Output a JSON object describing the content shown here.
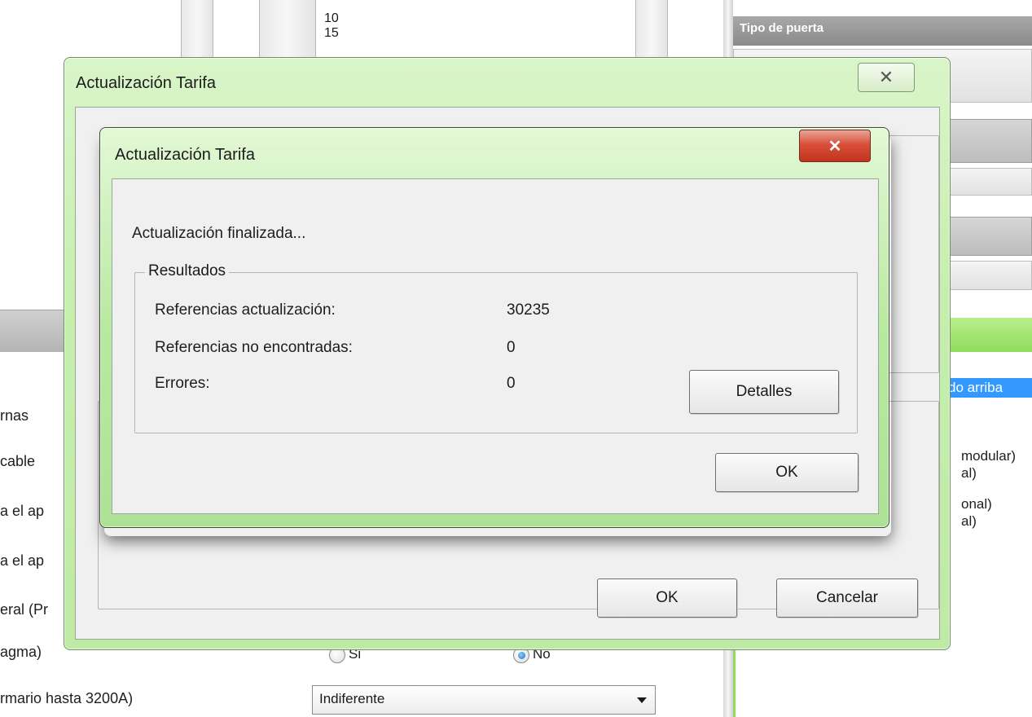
{
  "background": {
    "list_values": [
      "10",
      "15"
    ],
    "right_panel": {
      "header_title": "Tipo de puerta",
      "selected_item": "do arriba",
      "option_lines": [
        "modular)",
        "al)",
        "onal)",
        "al)"
      ]
    },
    "left_labels": [
      "rnas",
      "cable",
      "a el ap",
      "a el ap",
      "eral (Pr",
      "agma)",
      "rmario hasta 3200A)"
    ],
    "radio_si_label": "Si",
    "radio_no_label": "No",
    "dropdown_value": "Indiferente"
  },
  "outer_dialog": {
    "title": "Actualización Tarifa",
    "ok_label": "OK",
    "cancel_label": "Cancelar"
  },
  "inner_dialog": {
    "title": "Actualización Tarifa",
    "status_text": "Actualización finalizada...",
    "group_title": "Resultados",
    "results": [
      {
        "label": "Referencias actualización:",
        "value": "30235"
      },
      {
        "label": "Referencias no encontradas:",
        "value": "0"
      },
      {
        "label": "Errores:",
        "value": "0"
      }
    ],
    "details_label": "Detalles",
    "ok_label": "OK"
  }
}
